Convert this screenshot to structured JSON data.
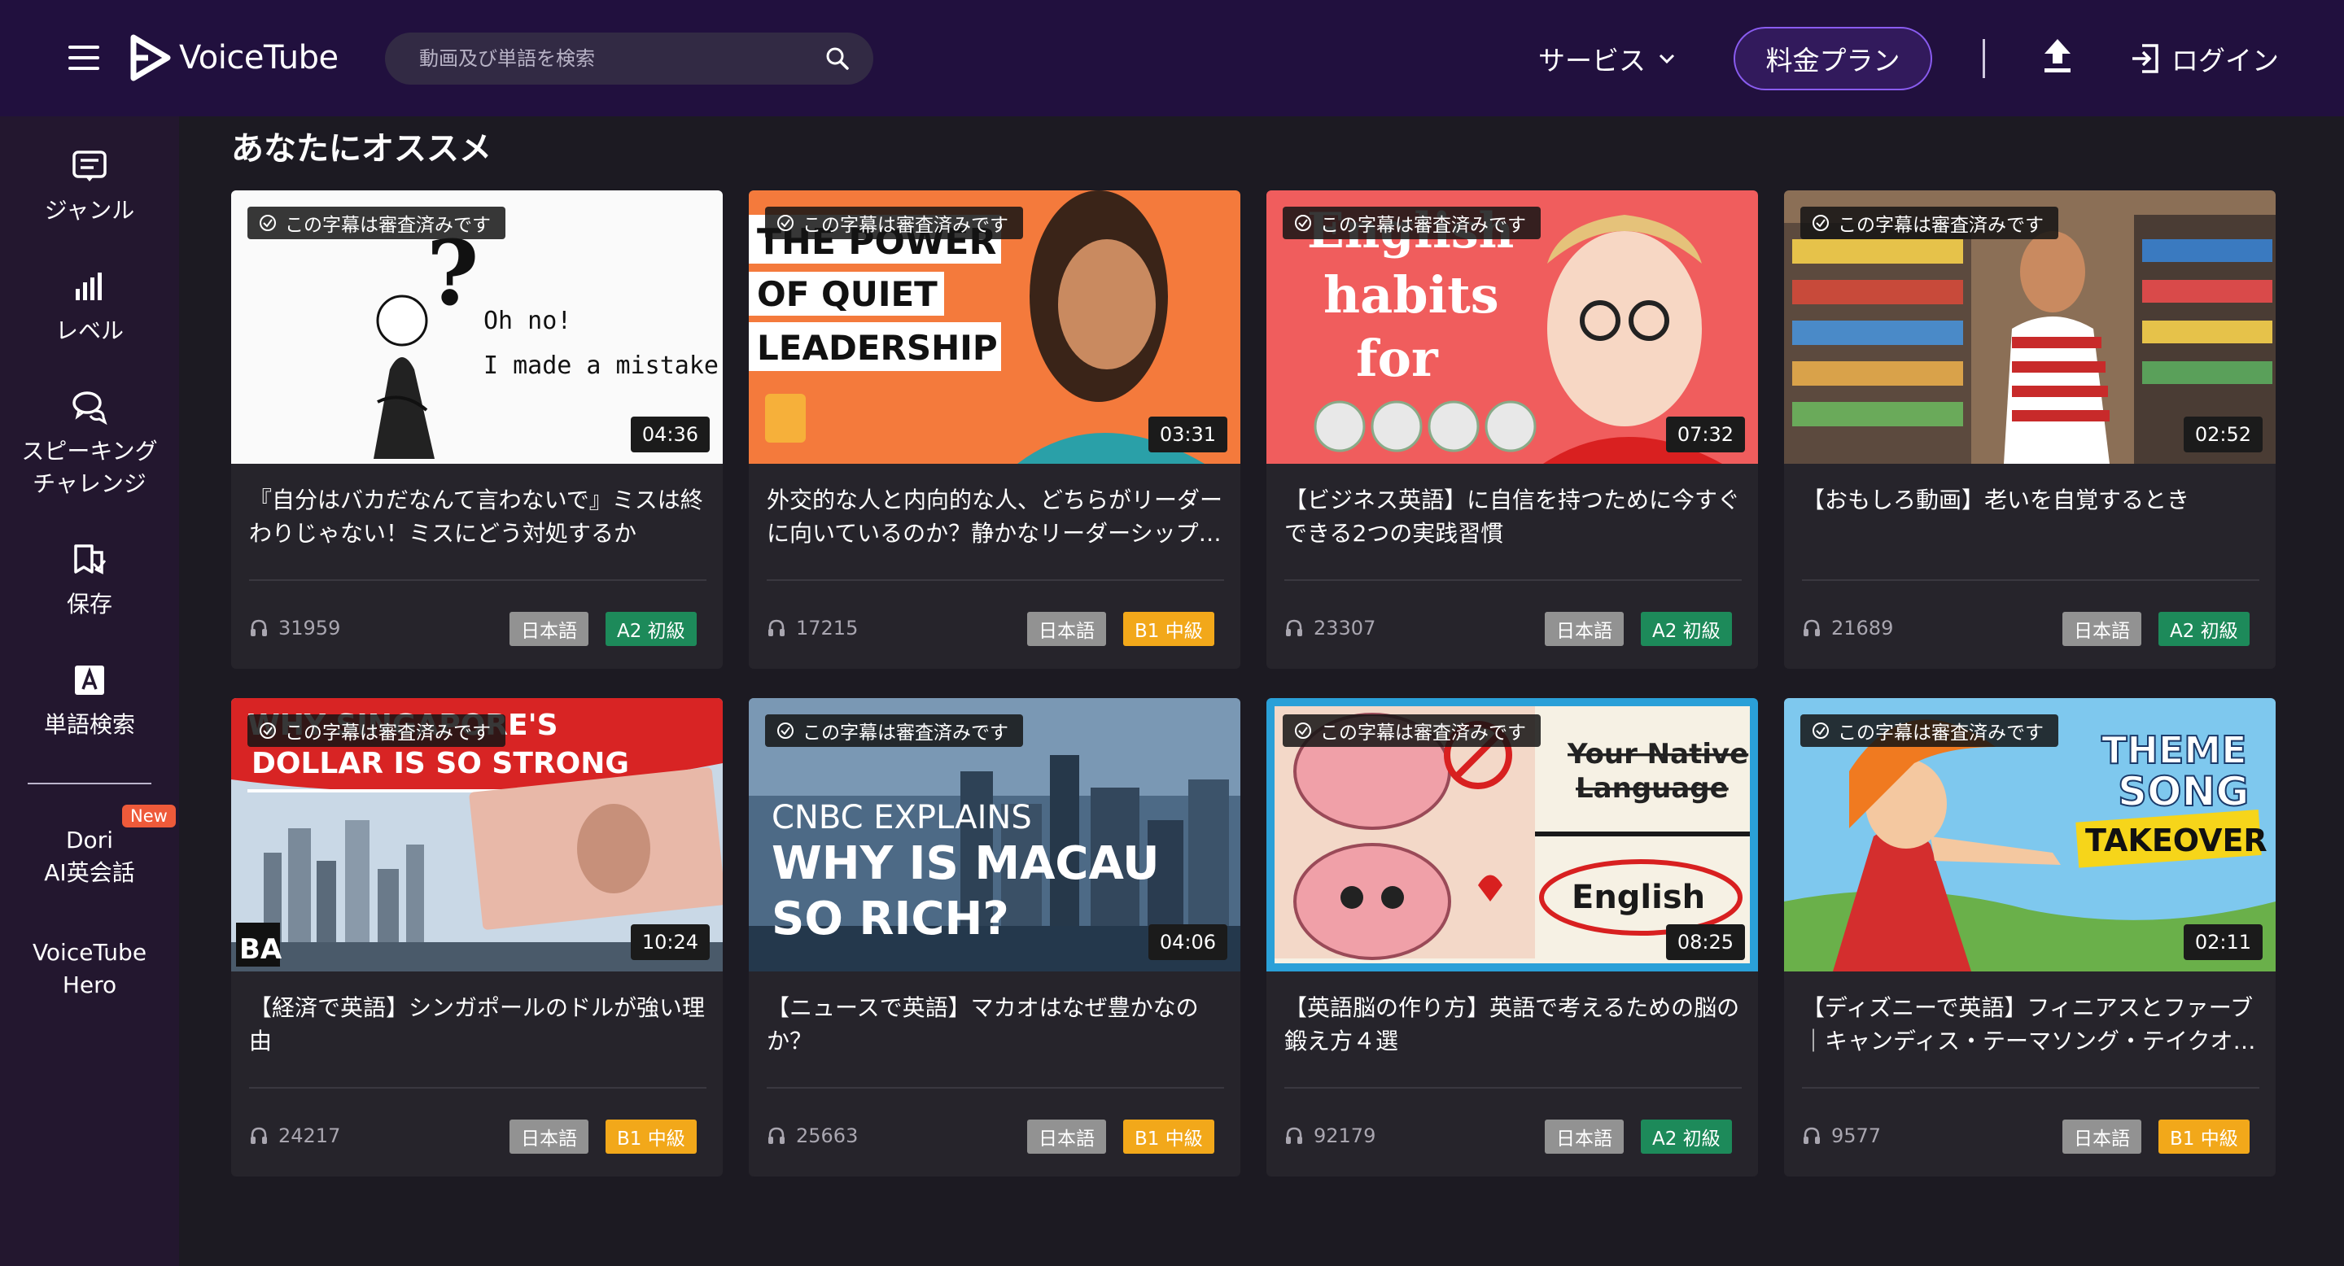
{
  "header": {
    "logo_text": "VoiceTube",
    "search_placeholder": "動画及び単語を検索",
    "service_label": "サービス",
    "plan_label": "料金プラン",
    "login_label": "ログイン"
  },
  "sidebar": {
    "items": [
      {
        "label": "ジャンル"
      },
      {
        "label": "レベル"
      },
      {
        "label": "スピーキング\nチャレンジ"
      },
      {
        "label": "保存"
      },
      {
        "label": "単語検索"
      }
    ],
    "dori_label_1": "Dori",
    "dori_label_2": "AI英会話",
    "new_badge": "New",
    "hero_label_1": "VoiceTube",
    "hero_label_2": "Hero"
  },
  "main": {
    "section_title": "あなたにオススメ",
    "verified_label": "この字幕は審査済みです",
    "videos": [
      {
        "duration": "04:36",
        "title": "『自分はバカだなんて言わないで』ミスは終わりじゃない！ミスにどう対処するか",
        "views": "31959",
        "lang": "日本語",
        "level": "A2 初級"
      },
      {
        "duration": "03:31",
        "title": "外交的な人と内向的な人、どちらがリーダーに向いているのか？静かなリーダーシップ…",
        "views": "17215",
        "lang": "日本語",
        "level": "B1 中級"
      },
      {
        "duration": "07:32",
        "title": "【ビジネス英語】に自信を持つために今すぐできる2つの実践習慣",
        "views": "23307",
        "lang": "日本語",
        "level": "A2 初級"
      },
      {
        "duration": "02:52",
        "title": "【おもしろ動画】老いを自覚するとき",
        "views": "21689",
        "lang": "日本語",
        "level": "A2 初級"
      },
      {
        "duration": "10:24",
        "title": "【経済で英語】シンガポールのドルが強い理由",
        "views": "24217",
        "lang": "日本語",
        "level": "B1 中級"
      },
      {
        "duration": "04:06",
        "title": "【ニュースで英語】マカオはなぜ豊かなのか？",
        "views": "25663",
        "lang": "日本語",
        "level": "B1 中級"
      },
      {
        "duration": "08:25",
        "title": "【英語脳の作り方】英語で考えるための脳の鍛え方４選",
        "views": "92179",
        "lang": "日本語",
        "level": "A2 初級"
      },
      {
        "duration": "02:11",
        "title": "【ディズニーで英語】フィニアスとファーブ｜キャンディス・テーマソング・テイクオ…",
        "views": "9577",
        "lang": "日本語",
        "level": "B1 中級"
      }
    ],
    "thumb_text": {
      "v1": [
        "Oh no!",
        "I made a mistake"
      ],
      "v2": [
        "THE POWER",
        "OF QUIET",
        "LEADERSHIP"
      ],
      "v3": [
        "English",
        "habits",
        "for"
      ],
      "v5": [
        "WHY SINGAPORE'S",
        "DOLLAR IS SO STRONG",
        "BA"
      ],
      "v6": [
        "CNBC EXPLAINS",
        "WHY IS MACAU",
        "SO RICH?"
      ],
      "v7": [
        "Your Native",
        "Language",
        "English"
      ],
      "v8": [
        "THEME",
        "SONG",
        "TAKEOVER"
      ]
    }
  },
  "colors": {
    "header_bg": "#21103e",
    "sidebar_bg": "#23172f",
    "page_bg": "#1c1a22",
    "card_bg": "#26242b",
    "level_a2": "#1d8a5a",
    "level_b1": "#f2a81a",
    "lang_tag": "#929292",
    "plan_border": "#8a5cf0"
  }
}
